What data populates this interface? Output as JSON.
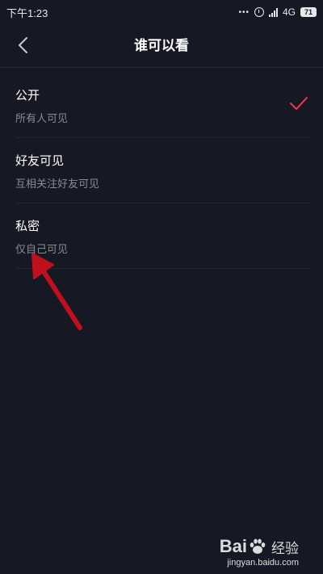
{
  "status_bar": {
    "time": "下午1:23",
    "dots": "•••",
    "network": "4G",
    "battery": "71"
  },
  "nav": {
    "title": "谁可以看"
  },
  "options": [
    {
      "title": "公开",
      "subtitle": "所有人可见",
      "selected": true
    },
    {
      "title": "好友可见",
      "subtitle": "互相关注好友可见",
      "selected": false
    },
    {
      "title": "私密",
      "subtitle": "仅自己可见",
      "selected": false
    }
  ],
  "colors": {
    "background": "#161823",
    "check": "#fe2c55",
    "annotation_arrow": "#c0101e"
  },
  "watermark": {
    "brand_left": "Bai",
    "brand_right": "经验",
    "url": "jingyan.baidu.com"
  }
}
